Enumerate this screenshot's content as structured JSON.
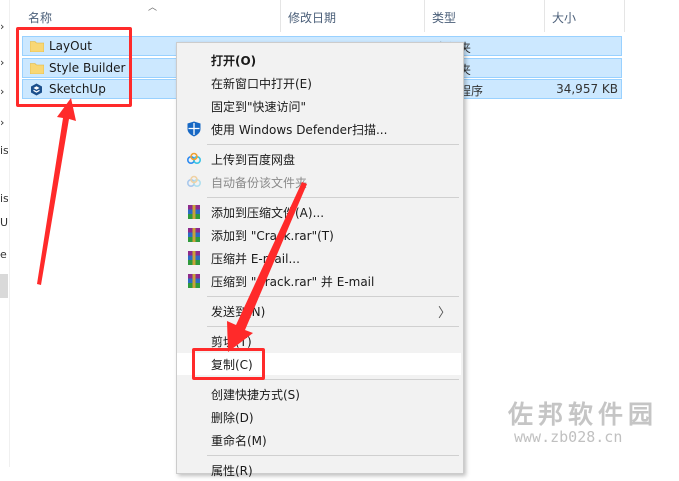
{
  "columns": {
    "name": "名称",
    "modified": "修改日期",
    "type": "类型",
    "size": "大小"
  },
  "files": [
    {
      "name": "LayOut",
      "type": "文件夹",
      "size": "",
      "icon": "folder-icon"
    },
    {
      "name": "Style Builder",
      "type": "文件夹",
      "size": "",
      "icon": "folder-icon"
    },
    {
      "name": "SketchUp",
      "type": "应用程序",
      "size": "34,957 KB",
      "icon": "sketchup-icon"
    }
  ],
  "nav_fragments": [
    "is",
    "is",
    "U",
    "e"
  ],
  "context_menu": {
    "open": "打开(O)",
    "open_new_window": "在新窗口中打开(E)",
    "pin_quick_access": "固定到\"快速访问\"",
    "defender": "使用 Windows Defender扫描...",
    "baidu_upload": "上传到百度网盘",
    "baidu_backup": "自动备份该文件夹",
    "add_to_archive": "添加到压缩文件(A)...",
    "add_to_crack": "添加到 \"Crack.rar\"(T)",
    "compress_email": "压缩并 E-mail...",
    "compress_crack_email": "压缩到 \"Crack.rar\" 并 E-mail",
    "send_to": "发送到(N)",
    "cut": "剪切(T)",
    "copy": "复制(C)",
    "create_shortcut": "创建快捷方式(S)",
    "delete": "删除(D)",
    "rename": "重命名(M)",
    "properties": "属性(R)"
  },
  "watermark": {
    "title": "佐邦软件园",
    "url": "www.zb028.cn"
  },
  "colors": {
    "selection": "#cce8ff",
    "selection_border": "#99d1ff",
    "menu_bg": "#f2f2f2",
    "annotation": "#ff2a2a",
    "folder": "#f8d775"
  }
}
